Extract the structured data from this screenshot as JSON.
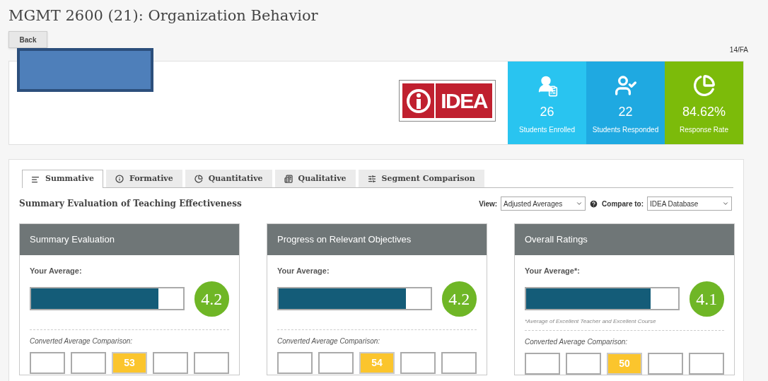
{
  "title": "MGMT 2600 (21): Organization Behavior",
  "back_button": "Back",
  "term": "14/FA",
  "logo_text": "IDEA",
  "stats": [
    {
      "kind": "enrolled",
      "value": "26",
      "label": "Students Enrolled",
      "color": "#29c4f0"
    },
    {
      "kind": "responded",
      "value": "22",
      "label": "Students Responded",
      "color": "#1fa9e1"
    },
    {
      "kind": "rate",
      "value": "84.62%",
      "label": "Response Rate",
      "color": "#7cbb0a"
    }
  ],
  "tabs": [
    {
      "kind": "summative",
      "label": "Summative",
      "selected": true
    },
    {
      "kind": "formative",
      "label": "Formative",
      "selected": false
    },
    {
      "kind": "quantitative",
      "label": "Quantitative",
      "selected": false
    },
    {
      "kind": "qualitative",
      "label": "Qualitative",
      "selected": false
    },
    {
      "kind": "segment",
      "label": "Segment Comparison",
      "selected": false
    }
  ],
  "section_title": "Summary Evaluation of Teaching Effectiveness",
  "view": {
    "label": "View:",
    "value": "Adjusted Averages"
  },
  "compare": {
    "label": "Compare to:",
    "value": "IDEA Database"
  },
  "panels": [
    {
      "title": "Summary Evaluation",
      "average_label": "Your Average:",
      "level": 0.84,
      "score": "4.2",
      "comparison_label": "Converted Average Comparison:",
      "boxes": [
        {
          "selected": false
        },
        {
          "selected": false
        },
        {
          "selected": true,
          "value": "53"
        },
        {
          "selected": false
        },
        {
          "selected": false
        }
      ]
    },
    {
      "title": "Progress on Relevant Objectives",
      "average_label": "Your Average:",
      "level": 0.84,
      "score": "4.2",
      "comparison_label": "Converted Average Comparison:",
      "boxes": [
        {
          "selected": false
        },
        {
          "selected": false
        },
        {
          "selected": true,
          "value": "54"
        },
        {
          "selected": false
        },
        {
          "selected": false
        }
      ]
    },
    {
      "title": "Overall Ratings",
      "average_label": "Your Average*:",
      "level": 0.82,
      "score": "4.1",
      "footnote": "*Average of Excellent Teacher and Excellent Course",
      "comparison_label": "Converted Average Comparison:",
      "boxes": [
        {
          "selected": false
        },
        {
          "selected": false
        },
        {
          "selected": true,
          "value": "50"
        },
        {
          "selected": false
        },
        {
          "selected": false
        }
      ]
    }
  ]
}
